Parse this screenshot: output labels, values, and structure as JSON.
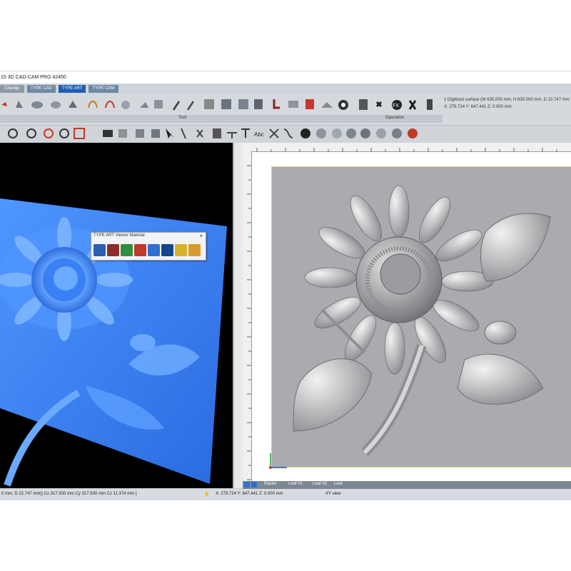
{
  "window": {
    "title": "15 3D CAD-CAM PRO 42450"
  },
  "ribbon": {
    "tabs": [
      "Change",
      "TYPE CAD",
      "TYPE ART",
      "TYPE CAM"
    ],
    "groups": {
      "tool": "Tool",
      "operation": "Operation"
    },
    "info": {
      "surface": "1 Digitized surface (W 635.000 mm, H 635.000 mm, D 22.747 mm",
      "coords": "X: 279.724  Y: 647.441  Z: 0.000 mm"
    },
    "text_tool": "Abc"
  },
  "popup": {
    "title": "TYPE ART Viewer Material",
    "close": "×"
  },
  "status": {
    "left": "0 mm, D 22.747 mm)| Cx 317.500 mm  Cy 317.500 mm  Cz 11.374 mm ]",
    "coords": "X: 279.724  Y: 647.441  Z: 0.000 mm",
    "view": "XY view"
  },
  "bottom_tabs": [
    "Raster",
    "Leaf #1",
    "Leaf #2",
    "Leaf"
  ],
  "colors": {
    "accent": "#1f5fb2",
    "preview3d": "#3a7ff0",
    "relief": "#a9abae"
  }
}
